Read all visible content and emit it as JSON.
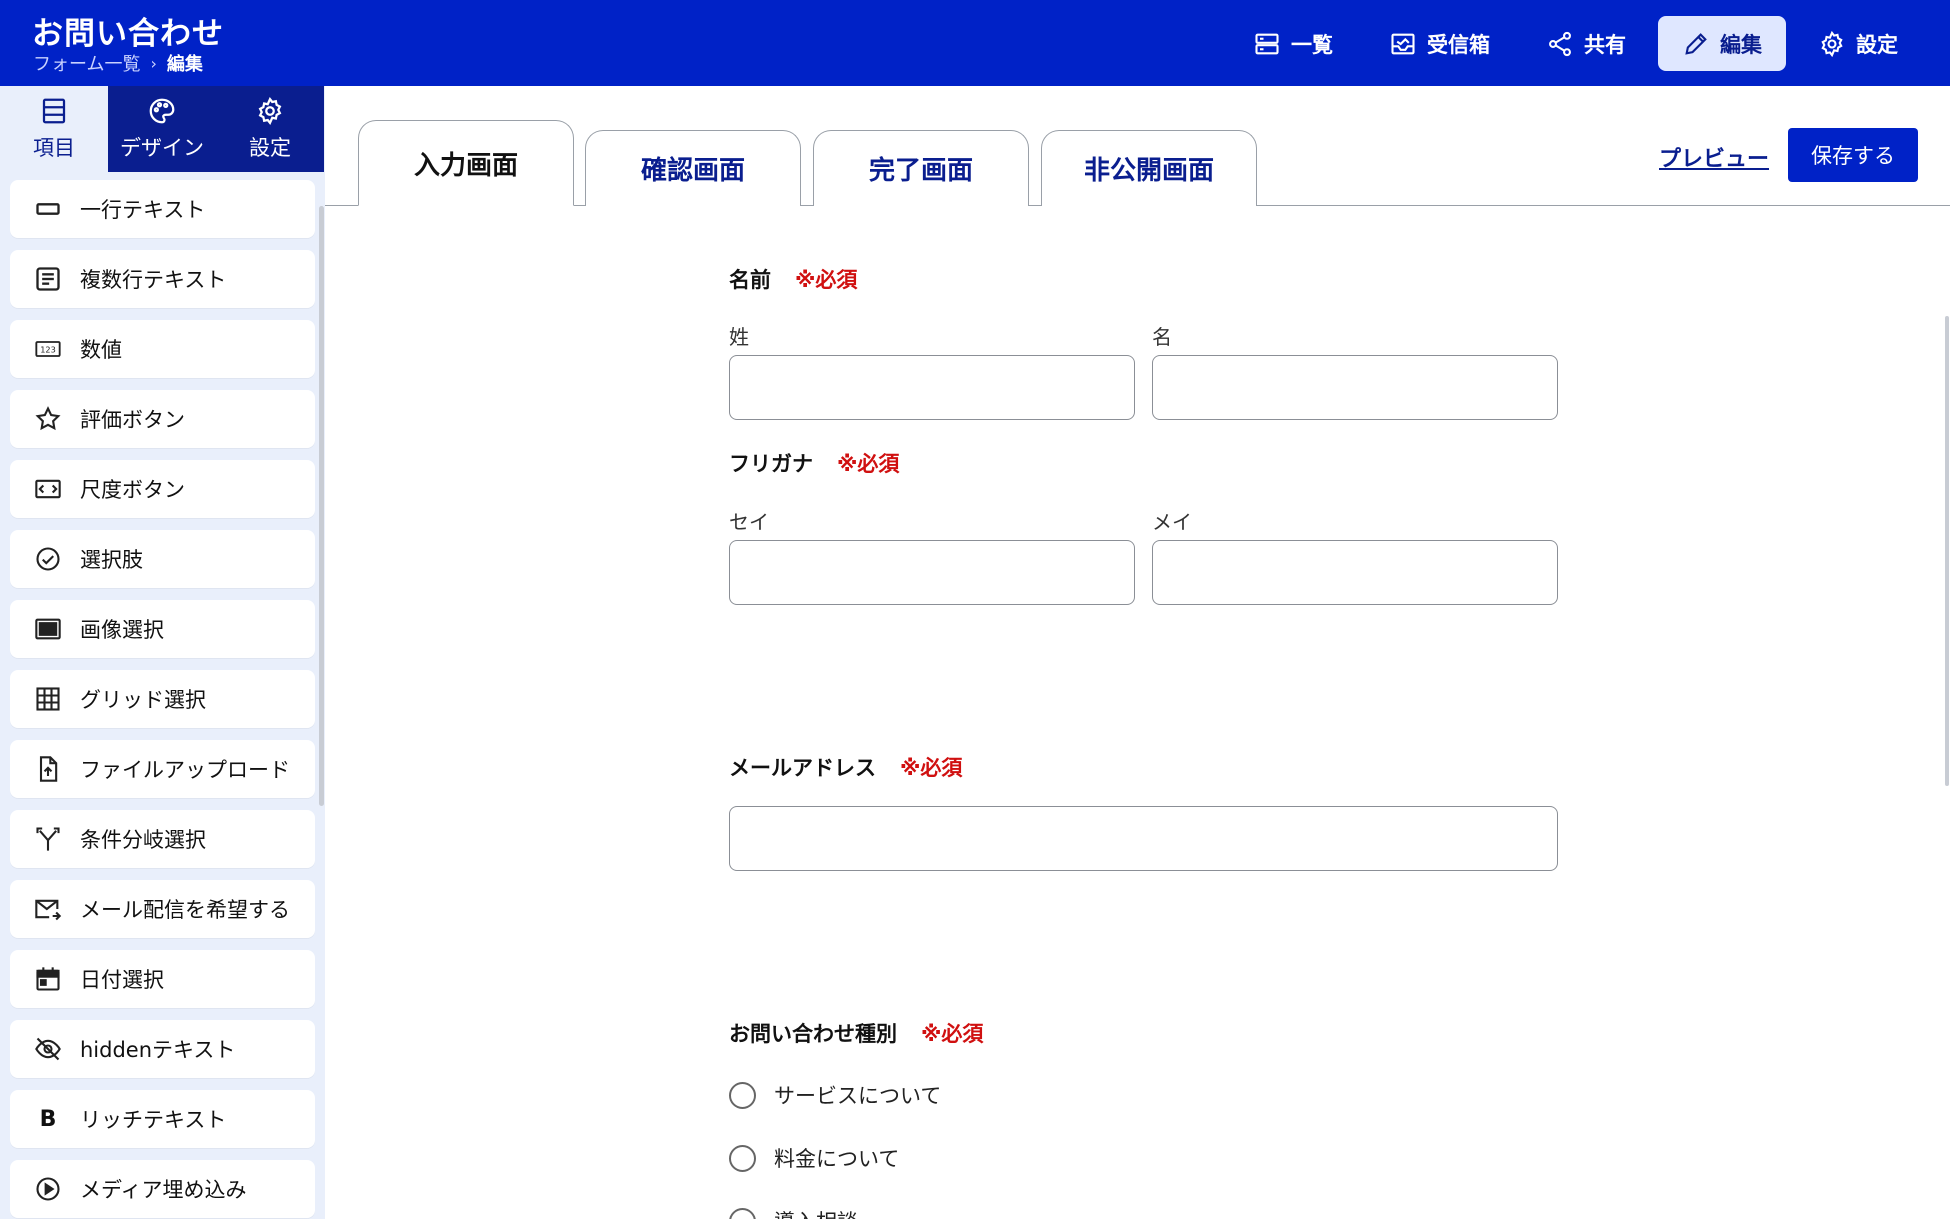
{
  "header": {
    "title": "お問い合わせ",
    "breadcrumb": {
      "parent": "フォーム一覧",
      "current": "編集"
    },
    "nav": [
      {
        "label": "一覧",
        "icon": "list-icon"
      },
      {
        "label": "受信箱",
        "icon": "inbox-icon"
      },
      {
        "label": "共有",
        "icon": "share-icon"
      },
      {
        "label": "編集",
        "icon": "pencil-icon",
        "active": true
      },
      {
        "label": "設定",
        "icon": "gear-icon"
      }
    ]
  },
  "sidebar": {
    "tabs": [
      {
        "label": "項目",
        "icon": "list-icon",
        "active": true
      },
      {
        "label": "デザイン",
        "icon": "palette-icon"
      },
      {
        "label": "設定",
        "icon": "gear-icon"
      }
    ],
    "items": [
      {
        "label": "一行テキスト",
        "icon": "single-line-icon"
      },
      {
        "label": "複数行テキスト",
        "icon": "multi-line-icon"
      },
      {
        "label": "数値",
        "icon": "number-icon"
      },
      {
        "label": "評価ボタン",
        "icon": "star-icon"
      },
      {
        "label": "尺度ボタン",
        "icon": "scale-icon"
      },
      {
        "label": "選択肢",
        "icon": "check-circle-icon"
      },
      {
        "label": "画像選択",
        "icon": "image-icon"
      },
      {
        "label": "グリッド選択",
        "icon": "grid-icon"
      },
      {
        "label": "ファイルアップロード",
        "icon": "file-upload-icon"
      },
      {
        "label": "条件分岐選択",
        "icon": "branch-icon"
      },
      {
        "label": "メール配信を希望する",
        "icon": "mail-icon"
      },
      {
        "label": "日付選択",
        "icon": "calendar-icon"
      },
      {
        "label": "hiddenテキスト",
        "icon": "eye-off-icon"
      },
      {
        "label": "リッチテキスト",
        "icon": "bold-icon"
      },
      {
        "label": "メディア埋め込み",
        "icon": "play-icon"
      }
    ]
  },
  "main": {
    "tabs": [
      {
        "label": "入力画面",
        "active": true
      },
      {
        "label": "確認画面"
      },
      {
        "label": "完了画面"
      },
      {
        "label": "非公開画面"
      }
    ],
    "preview_label": "プレビュー",
    "save_label": "保存する"
  },
  "form": {
    "required_text": "※必須",
    "name": {
      "label": "名前",
      "last": "姓",
      "first": "名"
    },
    "kana": {
      "label": "フリガナ",
      "last": "セイ",
      "first": "メイ"
    },
    "email": {
      "label": "メールアドレス"
    },
    "inquiry": {
      "label": "お問い合わせ種別",
      "options": [
        "サービスについて",
        "料金について",
        "導入相談"
      ]
    }
  }
}
